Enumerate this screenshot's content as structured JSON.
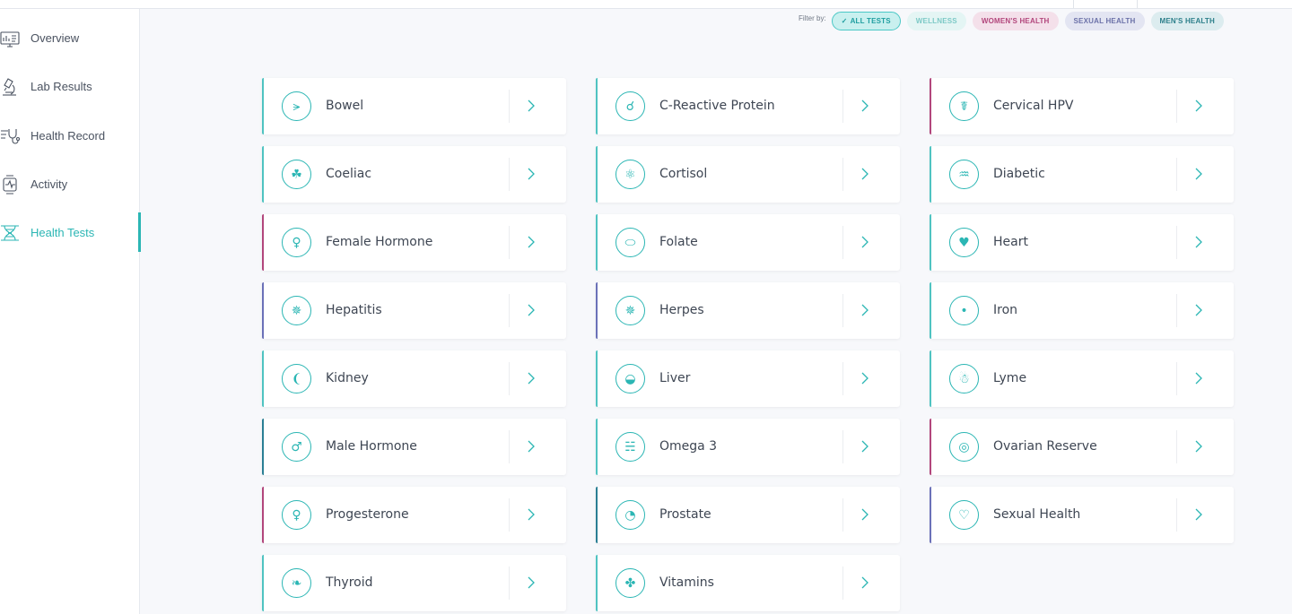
{
  "sidebar": {
    "items": [
      {
        "label": "Overview",
        "icon": "chart-monitor-icon",
        "active": false
      },
      {
        "label": "Lab Results",
        "icon": "microscope-icon",
        "active": false
      },
      {
        "label": "Health Record",
        "icon": "stethoscope-record-icon",
        "active": false
      },
      {
        "label": "Activity",
        "icon": "activity-watch-icon",
        "active": false
      },
      {
        "label": "Health Tests",
        "icon": "dna-icon",
        "active": true
      }
    ]
  },
  "filter": {
    "label": "Filter by:",
    "chips": [
      {
        "label": "ALL TESTS",
        "selected": true
      },
      {
        "label": "WELLNESS",
        "selected": false
      },
      {
        "label": "WOMEN'S HEALTH",
        "selected": false
      },
      {
        "label": "SEXUAL HEALTH",
        "selected": false
      },
      {
        "label": "MEN'S HEALTH",
        "selected": false
      }
    ]
  },
  "colors": {
    "teal": "#2bb6b4",
    "wellness": "#4fc3c1",
    "women": "#b2467c",
    "sexual": "#6b71b8",
    "men": "#2a7f94"
  },
  "tests": [
    {
      "label": "Bowel",
      "category": "wellness",
      "icon": "bowel-icon"
    },
    {
      "label": "C-Reactive Protein",
      "category": "wellness",
      "icon": "molecule-icon"
    },
    {
      "label": "Cervical HPV",
      "category": "women",
      "icon": "uterus-icon"
    },
    {
      "label": "Coeliac",
      "category": "wellness",
      "icon": "wheat-icon"
    },
    {
      "label": "Cortisol",
      "category": "wellness",
      "icon": "brain-icon"
    },
    {
      "label": "Diabetic",
      "category": "wellness",
      "icon": "pancreas-icon"
    },
    {
      "label": "Female Hormone",
      "category": "women",
      "icon": "female-symbol-icon"
    },
    {
      "label": "Folate",
      "category": "wellness",
      "icon": "pill-icon"
    },
    {
      "label": "Heart",
      "category": "wellness",
      "icon": "heart-organ-icon"
    },
    {
      "label": "Hepatitis",
      "category": "sexual",
      "icon": "virus-icon"
    },
    {
      "label": "Herpes",
      "category": "sexual",
      "icon": "virus-icon"
    },
    {
      "label": "Iron",
      "category": "wellness",
      "icon": "blood-drop-icon"
    },
    {
      "label": "Kidney",
      "category": "wellness",
      "icon": "kidney-icon"
    },
    {
      "label": "Liver",
      "category": "wellness",
      "icon": "liver-icon"
    },
    {
      "label": "Lyme",
      "category": "wellness",
      "icon": "tick-insect-icon"
    },
    {
      "label": "Male Hormone",
      "category": "men",
      "icon": "male-symbol-icon"
    },
    {
      "label": "Omega 3",
      "category": "wellness",
      "icon": "fish-icon"
    },
    {
      "label": "Ovarian Reserve",
      "category": "women",
      "icon": "ovary-icon"
    },
    {
      "label": "Progesterone",
      "category": "women",
      "icon": "female-symbol-icon"
    },
    {
      "label": "Prostate",
      "category": "men",
      "icon": "prostate-icon"
    },
    {
      "label": "Sexual Health",
      "category": "sexual",
      "icon": "heart-icon"
    },
    {
      "label": "Thyroid",
      "category": "wellness",
      "icon": "thyroid-icon"
    },
    {
      "label": "Vitamins",
      "category": "wellness",
      "icon": "vitamin-molecule-icon"
    }
  ]
}
